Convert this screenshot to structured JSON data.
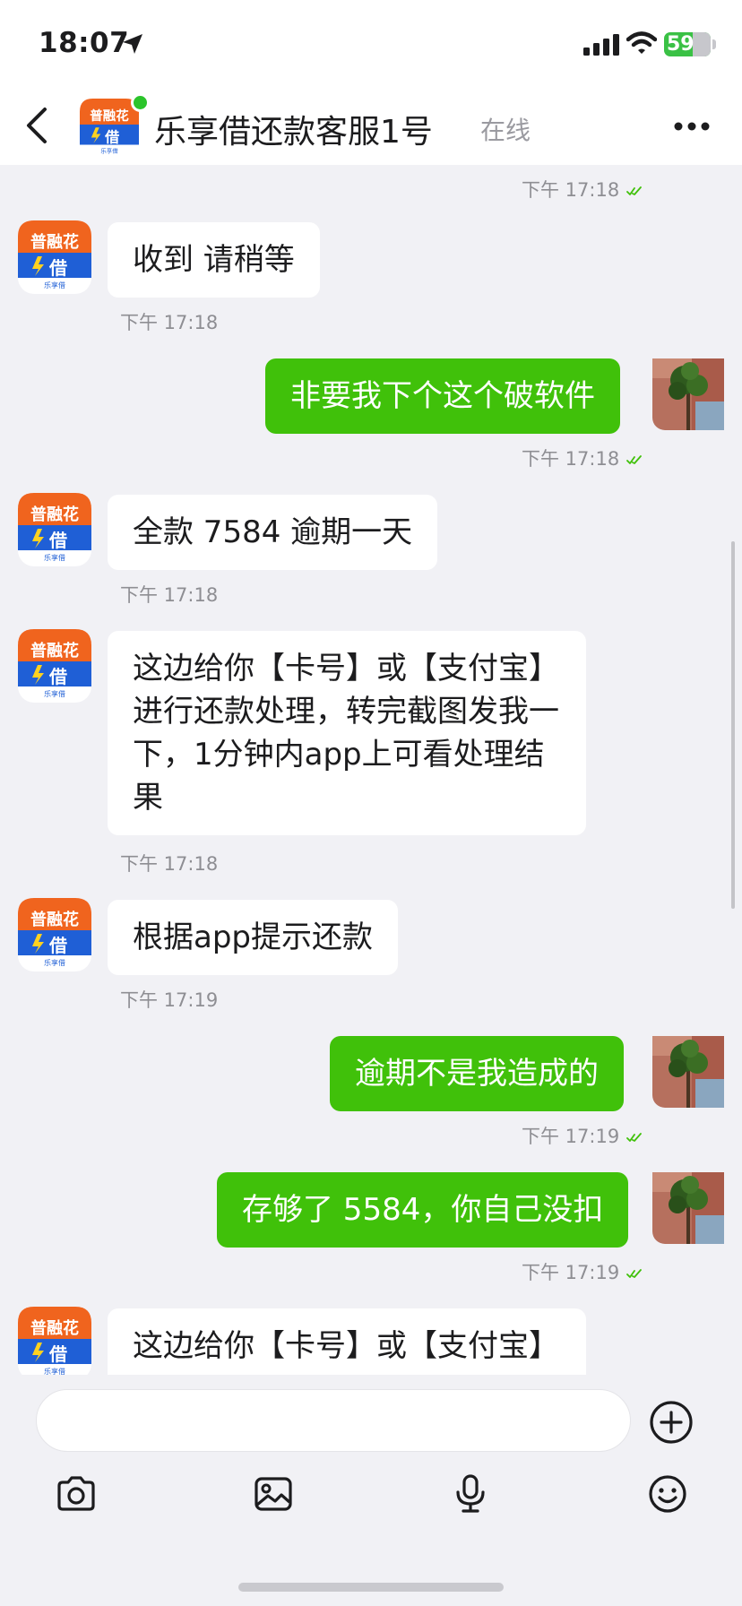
{
  "status_bar": {
    "time": "18:07",
    "battery": "59",
    "icons": [
      "location-arrow-icon",
      "cellular-signal-icon",
      "wifi-icon",
      "battery-icon"
    ]
  },
  "header": {
    "title": "乐享借还款客服1号",
    "status": "在线",
    "avatar_label": "普融花",
    "icons": [
      "back-chevron-icon",
      "more-dots-icon"
    ]
  },
  "messages": [
    {
      "side": "out",
      "text": "",
      "time": "下午 17:18",
      "read": true
    },
    {
      "side": "in",
      "text": "收到  请稍等",
      "time": "下午 17:18"
    },
    {
      "side": "out",
      "text": "非要我下个这个破软件",
      "time": "下午 17:18",
      "read": true
    },
    {
      "side": "in",
      "text": "全款  7584  逾期一天",
      "time": "下午 17:18"
    },
    {
      "side": "in",
      "text": "这边给你【卡号】或【支付宝】进行还款处理，转完截图发我一下，1分钟内app上可看处理结果",
      "time": "下午 17:18"
    },
    {
      "side": "in",
      "text": "根据app提示还款",
      "time": "下午 17:19"
    },
    {
      "side": "out",
      "text": "逾期不是我造成的",
      "time": "下午 17:19",
      "read": true
    },
    {
      "side": "out",
      "text": "存够了 5584，你自己没扣",
      "time": "下午 17:19",
      "read": true
    },
    {
      "side": "in",
      "text": "这边给你【卡号】或【支付宝】",
      "time": ""
    }
  ],
  "input": {
    "placeholder": ""
  },
  "toolbar": [
    "camera-icon",
    "image-icon",
    "microphone-icon",
    "emoji-icon",
    "plus-icon"
  ],
  "colors": {
    "outgoing_bubble": "#40c10a",
    "incoming_bubble": "#ffffff",
    "background": "#f1f1f5",
    "read_check": "#40c10a",
    "online": "#2bc42b"
  }
}
